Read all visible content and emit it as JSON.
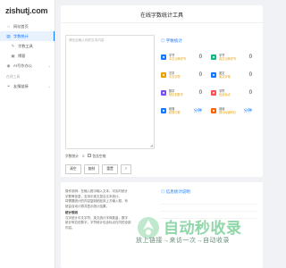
{
  "logo": "zishutj.com",
  "sidebar": {
    "items": [
      {
        "label": "网站首页",
        "icon": "home-icon"
      },
      {
        "label": "字数统计",
        "icon": "chart-icon",
        "active": true
      },
      {
        "label": "字数工具",
        "icon": "tool-icon",
        "sub": true
      },
      {
        "label": "博客",
        "icon": "book-icon",
        "sub": true
      },
      {
        "label": "AI写作办公",
        "icon": "robot-icon",
        "arrow": true
      }
    ],
    "section": "在线工具",
    "extra_items": [
      {
        "label": "友情链接",
        "icon": "link-icon",
        "arrow": true
      }
    ]
  },
  "main": {
    "title": "在线字数统计工具",
    "editor_placeholder": "请在此输入你的文本内容",
    "count_label": "字数统计",
    "count_value": "0",
    "include_label": "包含空格",
    "buttons": [
      "清空",
      "复制",
      "重置",
      "?"
    ]
  },
  "stats": {
    "header": "字数统计",
    "items": [
      {
        "label": "字节",
        "sub": "中文占两字节",
        "value": "0",
        "color": "#1677ff",
        "icon": "byte-icon"
      },
      {
        "label": "字节",
        "sub": "英文占两字节",
        "value": "0",
        "color": "#12b886",
        "icon": "byte-icon"
      },
      {
        "label": "汉字",
        "sub": "中文字符",
        "value": "0",
        "color": "#e8a000",
        "icon": "hanzi-icon"
      },
      {
        "label": "英文",
        "sub": "英文字母",
        "value": "0",
        "color": "#1677ff",
        "icon": "letter-icon"
      },
      {
        "label": "数字",
        "sub": "阿拉伯数字",
        "value": "0",
        "color": "#7950f2",
        "icon": "number-icon"
      },
      {
        "label": "字符",
        "sub": "包含标点",
        "value": "0",
        "color": "#fa5252",
        "icon": "char-icon"
      },
      {
        "label": "段落",
        "sub": "段落行数",
        "value": "分钟",
        "color": "#1677ff",
        "icon": "para-icon",
        "unit": true
      },
      {
        "label": "阅读",
        "sub": "预计阅读时长",
        "value": "分钟",
        "color": "#f76707",
        "icon": "read-icon",
        "unit": true
      }
    ]
  },
  "bottom": {
    "left_lines": [
      "操作说明：在输入框中输入文本，可实时统计",
      "字数等信息，支持中英文混合文本统计。",
      "将需要统计的内容复制粘贴到上方输入框，系",
      "统会自动计算并显示统计结果。"
    ],
    "left_head": "统计规则",
    "left_lines2": [
      "汉字统计中文字符，英文统计字母数量，数字",
      "统计阿拉伯数字，字符统计包含标点在内的全部",
      "内容。"
    ],
    "right_head": "信息统计说明"
  },
  "watermark": {
    "title": "自动秒收录",
    "sub": "放上链接→来访一次→自动收录"
  }
}
